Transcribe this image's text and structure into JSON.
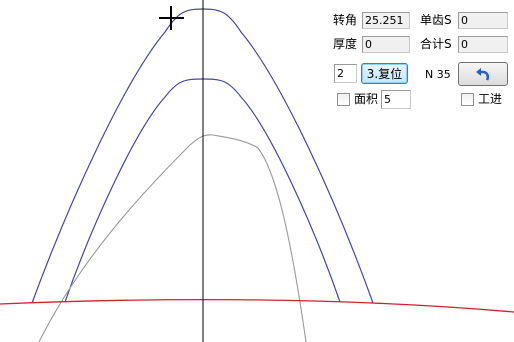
{
  "panel": {
    "rotation_label": "转角",
    "rotation_value": "25.251",
    "thickness_label": "厚度",
    "thickness_value": "0",
    "single_tooth_label": "单齿S",
    "single_tooth_value": "0",
    "total_label": "合计S",
    "total_value": "0",
    "step_value": "2",
    "reset_button_label": "3.复位",
    "n_label": "N 35",
    "area_label": "面积",
    "area_value": "5",
    "area_checked": false,
    "feed_label": "工进",
    "feed_checked": false,
    "undo_icon": "undo-arrow-icon"
  },
  "colors": {
    "tooth_outline": "#4646a0",
    "inner_outline": "#4646a0",
    "measured_profile": "#9a9a9a",
    "base_arc": "#d22030",
    "center_axis": "#000000",
    "undo_arrow": "#2a5fc8"
  }
}
